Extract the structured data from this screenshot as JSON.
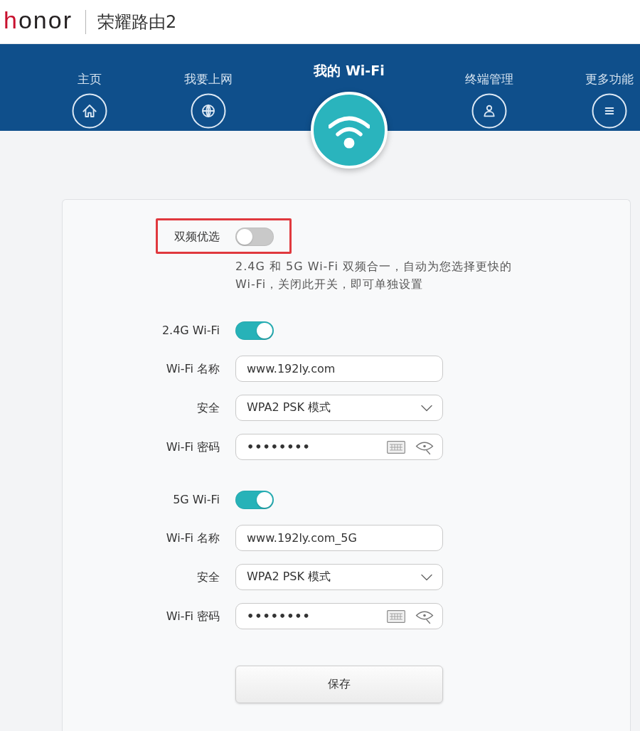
{
  "header": {
    "logo": "honor",
    "title": "荣耀路由2"
  },
  "nav": [
    {
      "label": "主页",
      "kind": "home",
      "selected": false
    },
    {
      "label": "我要上网",
      "kind": "globe",
      "selected": false
    },
    {
      "label": "我的 Wi-Fi",
      "kind": "wifi",
      "selected": true
    },
    {
      "label": "终端管理",
      "kind": "person",
      "selected": false
    },
    {
      "label": "更多功能",
      "kind": "menu",
      "selected": false
    }
  ],
  "dual_band": {
    "label": "双频优选",
    "on": false,
    "highlighted": true,
    "description": "2.4G 和 5G Wi-Fi 双频合一，自动为您选择更快的Wi-Fi，关闭此开关，即可单独设置"
  },
  "bands": [
    {
      "label": "2.4G Wi-Fi",
      "on": true,
      "fields": [
        {
          "kind": "text",
          "label": "Wi-Fi 名称",
          "value": "www.192ly.com"
        },
        {
          "kind": "select",
          "label": "安全",
          "value": "WPA2 PSK 模式"
        },
        {
          "kind": "password",
          "label": "Wi-Fi 密码",
          "value": "••••••••"
        }
      ]
    },
    {
      "label": "5G Wi-Fi",
      "on": true,
      "fields": [
        {
          "kind": "text",
          "label": "Wi-Fi 名称",
          "value": "www.192ly.com_5G"
        },
        {
          "kind": "select",
          "label": "安全",
          "value": "WPA2 PSK 模式"
        },
        {
          "kind": "password",
          "label": "Wi-Fi 密码",
          "value": "••••••••"
        }
      ]
    }
  ],
  "save_button": "保存"
}
